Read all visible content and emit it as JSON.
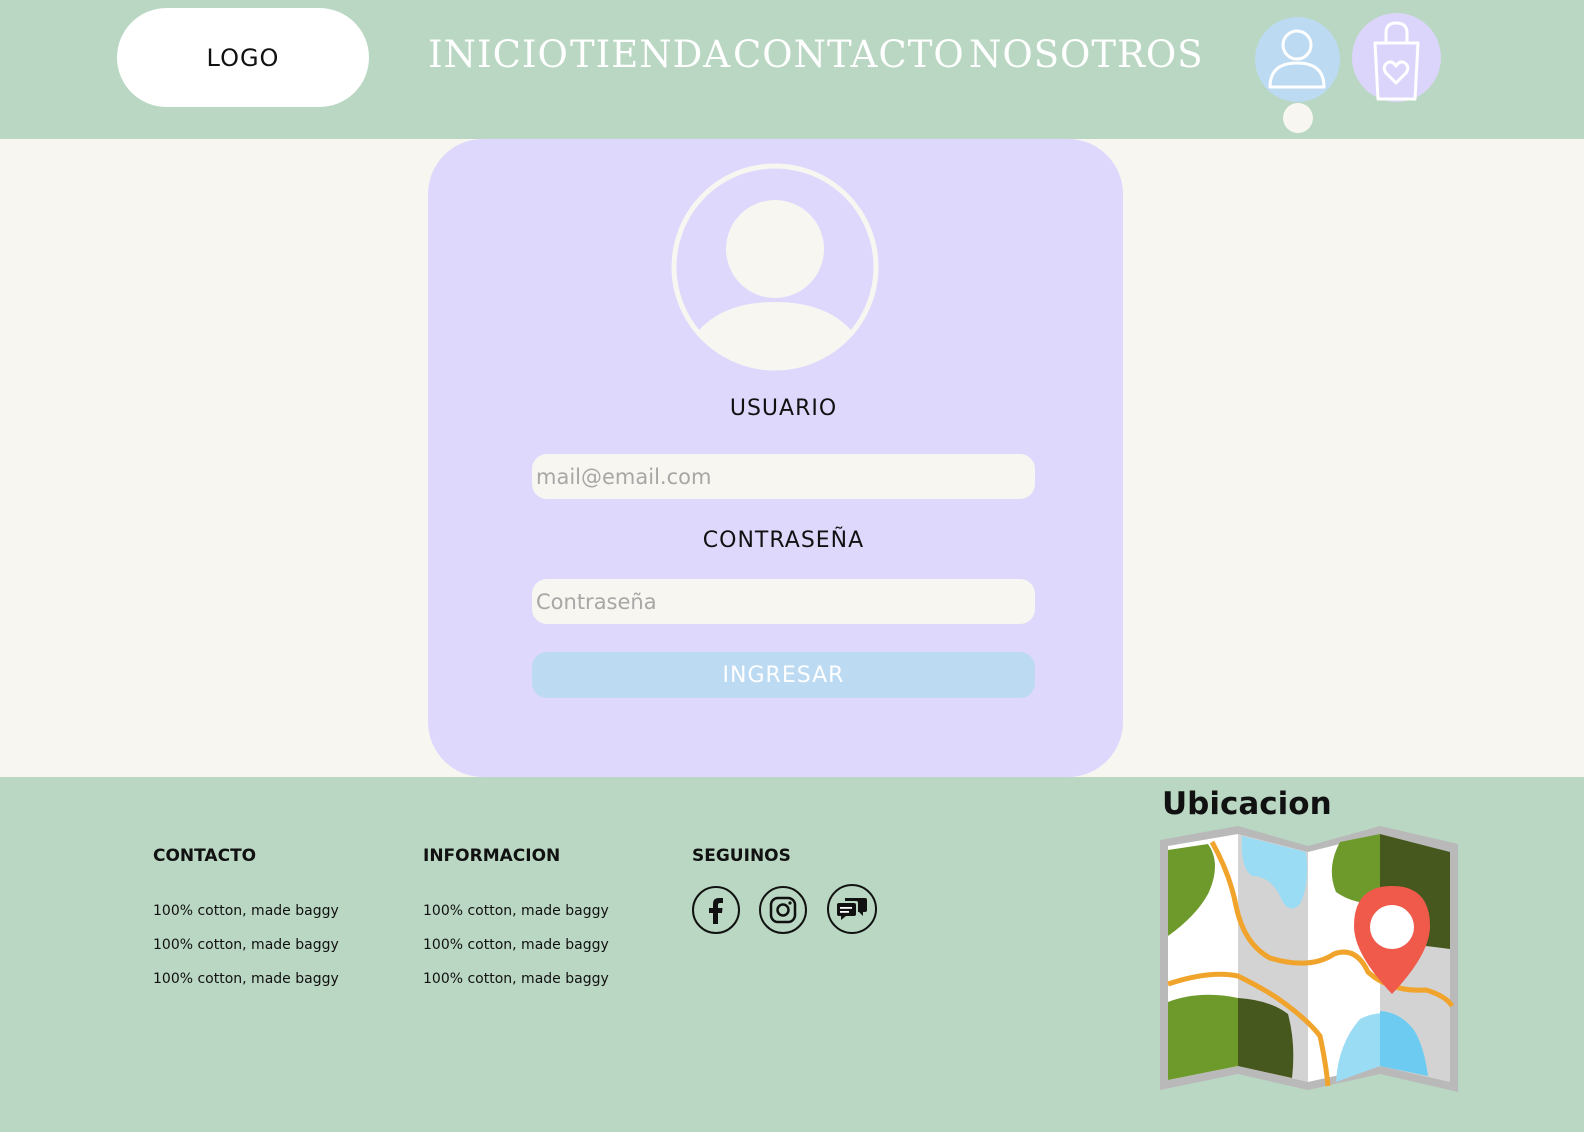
{
  "header": {
    "logo": "LOGO",
    "nav": [
      "INICIO",
      "TIENDA",
      "CONTACTO",
      "NOSOTROS"
    ],
    "icons": {
      "user": "user-icon",
      "cart": "shopping-bag-heart-icon"
    }
  },
  "login": {
    "user_label": "USUARIO",
    "email_placeholder": "mail@email.com",
    "email_value": "",
    "password_label": "CONTRASEÑA",
    "password_placeholder": "Contraseña",
    "password_value": "",
    "submit_label": "INGRESAR"
  },
  "footer": {
    "columns": [
      {
        "title": "CONTACTO",
        "items": [
          "100% cotton, made baggy",
          "100% cotton, made baggy",
          "100% cotton, made baggy"
        ]
      },
      {
        "title": "INFORMACION",
        "items": [
          "100% cotton, made baggy",
          "100% cotton, made baggy",
          "100% cotton, made baggy"
        ]
      },
      {
        "title": "SEGUINOS"
      }
    ],
    "social": [
      "facebook-icon",
      "instagram-icon",
      "chat-icon"
    ],
    "map_title": "Ubicacion"
  },
  "colors": {
    "green": "#b9d7c2",
    "lavender": "#ded8fd",
    "light_blue": "#bcdaf2",
    "cream": "#f8f6f1"
  }
}
